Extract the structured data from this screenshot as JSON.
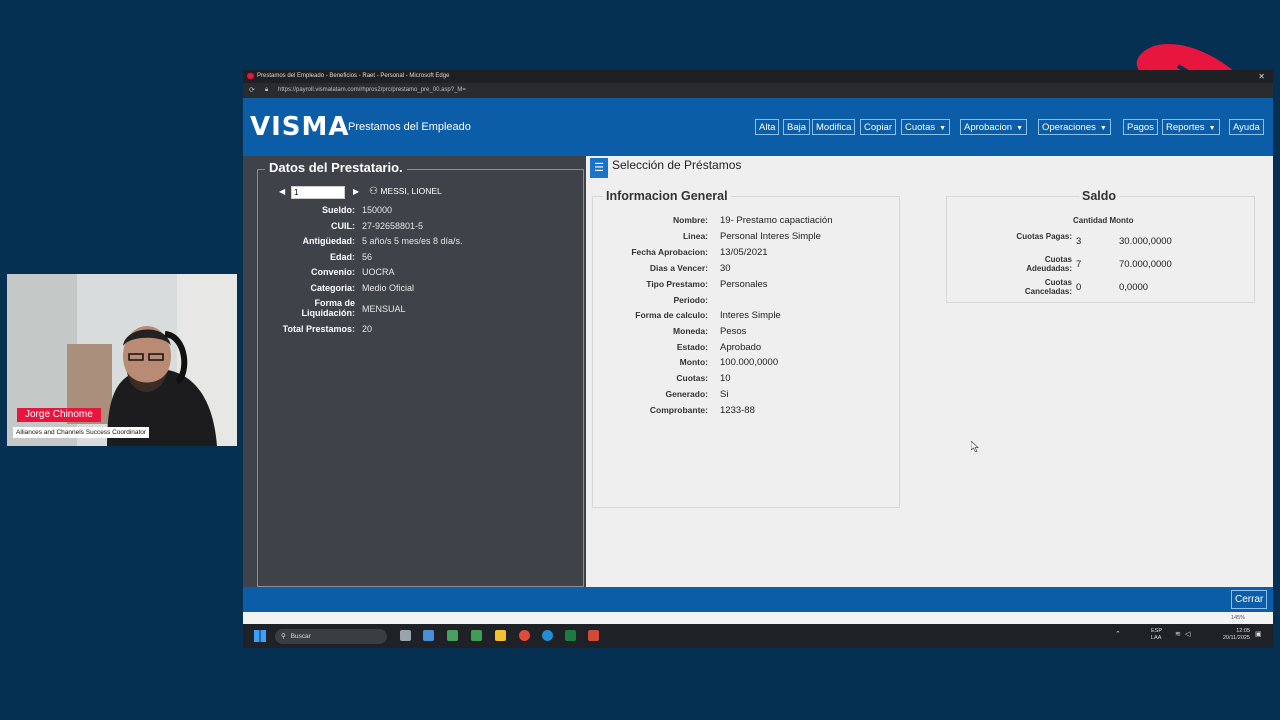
{
  "browser": {
    "title": "Prestamos del Empleado - Beneficios - Raet - Personal - Microsoft Edge",
    "url": "https://payroll.vismalatam.com/rhpros2/prc/prestamo_pre_00.asp?_M="
  },
  "header": {
    "logo": "VISMA",
    "app_title": "Prestamos del Empleado",
    "toolbar": {
      "alta": "Alta",
      "baja": "Baja",
      "modifica": "Modifica",
      "copiar": "Copiar",
      "cuotas": "Cuotas",
      "aprobacion": "Aprobacion",
      "operaciones": "Operaciones",
      "pagos": "Pagos",
      "reportes": "Reportes",
      "ayuda": "Ayuda"
    }
  },
  "left_panel": {
    "title": "Datos del Prestatario.",
    "pager_value": "1",
    "employee_name": "MESSI, LIONEL",
    "fields": {
      "sueldo": {
        "label": "Sueldo:",
        "value": "150000"
      },
      "cuil": {
        "label": "CUIL:",
        "value": "27-92658801-5"
      },
      "antiguedad": {
        "label": "Antigüedad:",
        "value": "5 año/s 5 mes/es 8 día/s."
      },
      "edad": {
        "label": "Edad:",
        "value": "56"
      },
      "convenio": {
        "label": "Convenio:",
        "value": "UOCRA"
      },
      "categoria": {
        "label": "Categoria:",
        "value": "Medio Oficial"
      },
      "forma_liquidacion": {
        "label": "Forma de Liquidación:",
        "value": "MENSUAL"
      },
      "total_prestamos": {
        "label": "Total Prestamos:",
        "value": "20"
      }
    }
  },
  "content": {
    "section_title": "Selección de Préstamos",
    "info_general": {
      "title": "Informacion General",
      "nombre": {
        "label": "Nombre:",
        "value": "19- Prestamo capactiación"
      },
      "linea": {
        "label": "Linea:",
        "value": "Personal Interes Simple"
      },
      "fecha_aprobacion": {
        "label": "Fecha Aprobacion:",
        "value": "13/05/2021"
      },
      "dias_vencer": {
        "label": "Dias a Vencer:",
        "value": "30"
      },
      "tipo_prestamo": {
        "label": "Tipo Prestamo:",
        "value": "Personales"
      },
      "periodo": {
        "label": "Periodo:",
        "value": ""
      },
      "forma_calculo": {
        "label": "Forma de calculo:",
        "value": "Interes Simple"
      },
      "moneda": {
        "label": "Moneda:",
        "value": "Pesos"
      },
      "estado": {
        "label": "Estado:",
        "value": "Aprobado"
      },
      "monto": {
        "label": "Monto:",
        "value": "100.000,0000"
      },
      "cuotas": {
        "label": "Cuotas:",
        "value": "10"
      },
      "generado": {
        "label": "Generado:",
        "value": "Si"
      },
      "comprobante": {
        "label": "Comprobante:",
        "value": "1233-88"
      }
    },
    "saldo": {
      "title": "Saldo",
      "head_cantidad": "Cantidad",
      "head_monto": "Monto",
      "pagas": {
        "label": "Cuotas Pagas:",
        "cantidad": "3",
        "monto": "30.000,0000"
      },
      "adeudadas": {
        "label": "Cuotas Adeudadas:",
        "cantidad": "7",
        "monto": "70.000,0000"
      },
      "canceladas": {
        "label": "Cuotas Canceladas:",
        "cantidad": "0",
        "monto": "0,0000"
      }
    }
  },
  "footer": {
    "cerrar": "Cerrar",
    "zoom": "145%"
  },
  "taskbar": {
    "search_placeholder": "Buscar",
    "lang": "ESP",
    "lang2": "LAA",
    "time": "12:05",
    "date": "20/11/2025"
  },
  "webcam": {
    "name": "Jorge Chinome",
    "role": "Alliances and Channels Success Coordinator"
  },
  "colors": {
    "brand_blue": "#0b5da8",
    "background": "#063051",
    "accent_red": "#e8153f",
    "panel_dark": "#3f4249"
  }
}
